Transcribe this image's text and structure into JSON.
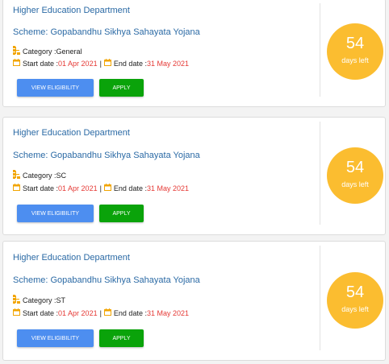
{
  "colors": {
    "accent_blue": "#2b6aa5",
    "date_red": "#e53935",
    "badge_orange": "#fbbd30",
    "view_button": "#4d8ef0",
    "apply_button": "#0aa30a"
  },
  "labels": {
    "category_prefix": "Category : ",
    "start_prefix": "Start date : ",
    "end_prefix": "End date : ",
    "separator": "|",
    "view_button": "VIEW ELIGIBILITY",
    "apply_button": "APPLY",
    "days_left": "days left"
  },
  "icons": {
    "category": "category-tree-icon",
    "date": "calendar-icon"
  },
  "schemes": [
    {
      "department": "Higher Education Department",
      "scheme": "Scheme: Gopabandhu Sikhya Sahayata Yojana",
      "category": "General",
      "start_date": "01 Apr 2021",
      "end_date": "31 May 2021",
      "days": "54"
    },
    {
      "department": "Higher Education Department",
      "scheme": "Scheme: Gopabandhu Sikhya Sahayata Yojana",
      "category": "SC",
      "start_date": "01 Apr 2021",
      "end_date": "31 May 2021",
      "days": "54"
    },
    {
      "department": "Higher Education Department",
      "scheme": "Scheme: Gopabandhu Sikhya Sahayata Yojana",
      "category": "ST",
      "start_date": "01 Apr 2021",
      "end_date": "31 May 2021",
      "days": "54"
    }
  ]
}
